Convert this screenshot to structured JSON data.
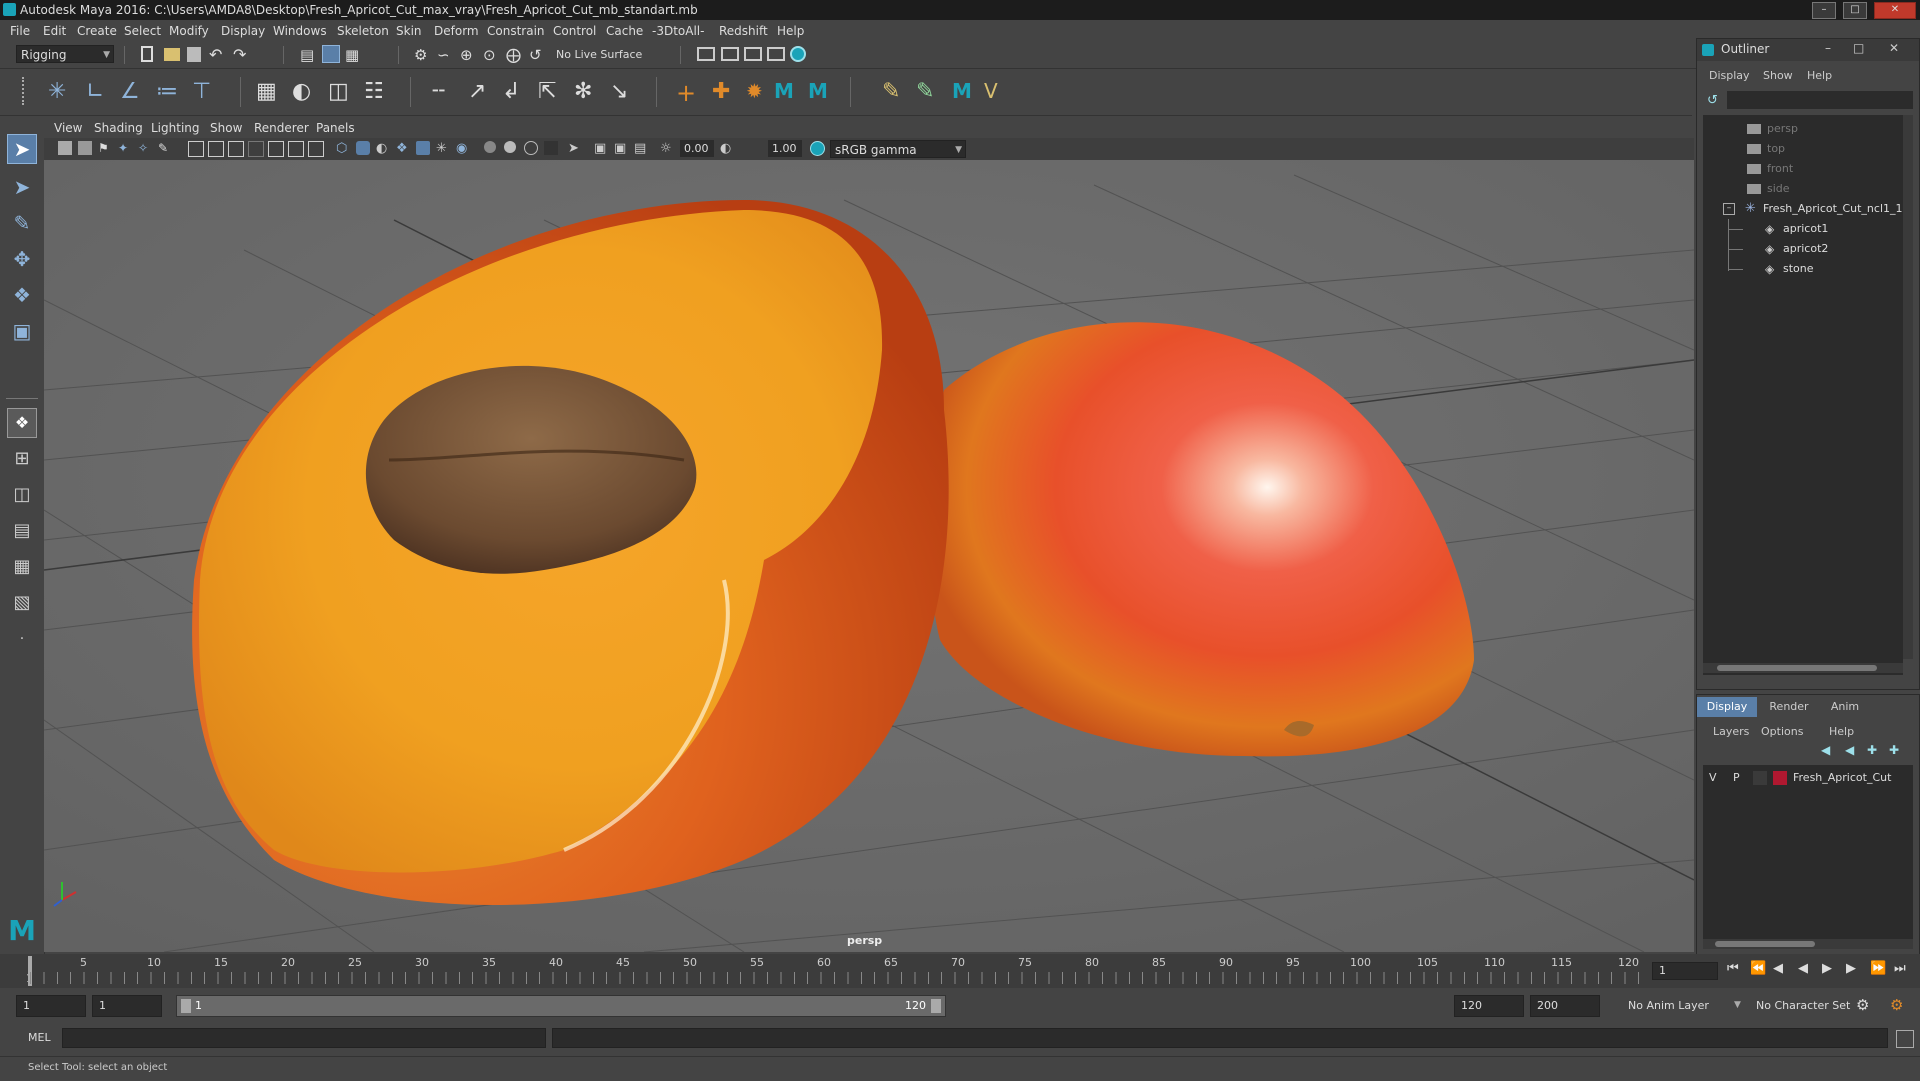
{
  "window": {
    "title": "Autodesk Maya 2016: C:\\Users\\AMDA8\\Desktop\\Fresh_Apricot_Cut_max_vray\\Fresh_Apricot_Cut_mb_standart.mb"
  },
  "menubar": [
    "File",
    "Edit",
    "Create",
    "Select",
    "Modify",
    "Display",
    "Windows",
    "Skeleton",
    "Skin",
    "Deform",
    "Constrain",
    "Control",
    "Cache",
    "-3DtoAll-",
    "Redshift",
    "Help"
  ],
  "statusline": {
    "menuset": "Rigging",
    "live_surface": "No Live Surface"
  },
  "panel": {
    "menus": [
      "View",
      "Shading",
      "Lighting",
      "Show",
      "Renderer",
      "Panels"
    ],
    "exposure": "0.00",
    "gamma": "1.00",
    "colorspace": "sRGB gamma",
    "camera_label": "persp"
  },
  "outliner": {
    "title": "Outliner",
    "menus": [
      "Display",
      "Show",
      "Help"
    ],
    "items": [
      {
        "label": "persp",
        "type": "camera"
      },
      {
        "label": "top",
        "type": "camera"
      },
      {
        "label": "front",
        "type": "camera"
      },
      {
        "label": "side",
        "type": "camera"
      },
      {
        "label": "Fresh_Apricot_Cut_ncl1_1",
        "type": "group"
      },
      {
        "label": "apricot1",
        "type": "mesh"
      },
      {
        "label": "apricot2",
        "type": "mesh"
      },
      {
        "label": "stone",
        "type": "mesh"
      }
    ]
  },
  "layers": {
    "tabs": [
      "Display",
      "Render",
      "Anim"
    ],
    "menus": [
      "Layers",
      "Options",
      "Help"
    ],
    "layer": {
      "v": "V",
      "p": "P",
      "name": "Fresh_Apricot_Cut",
      "color": "#b01830"
    }
  },
  "timeline": {
    "ticks": [
      "5",
      "10",
      "15",
      "20",
      "25",
      "30",
      "35",
      "40",
      "45",
      "50",
      "55",
      "60",
      "65",
      "70",
      "75",
      "80",
      "85",
      "90",
      "95",
      "100",
      "105",
      "110",
      "115",
      "120"
    ],
    "start_label": "1",
    "current_frame": "1"
  },
  "range": {
    "start": "1",
    "playback_start": "1",
    "slider_start": "1",
    "slider_end": "120",
    "playback_end": "120",
    "end": "200",
    "anim_layer": "No Anim Layer",
    "character_set": "No Character Set"
  },
  "cmdline": {
    "label": "MEL"
  },
  "helpline": {
    "text": "Select Tool: select an object"
  }
}
